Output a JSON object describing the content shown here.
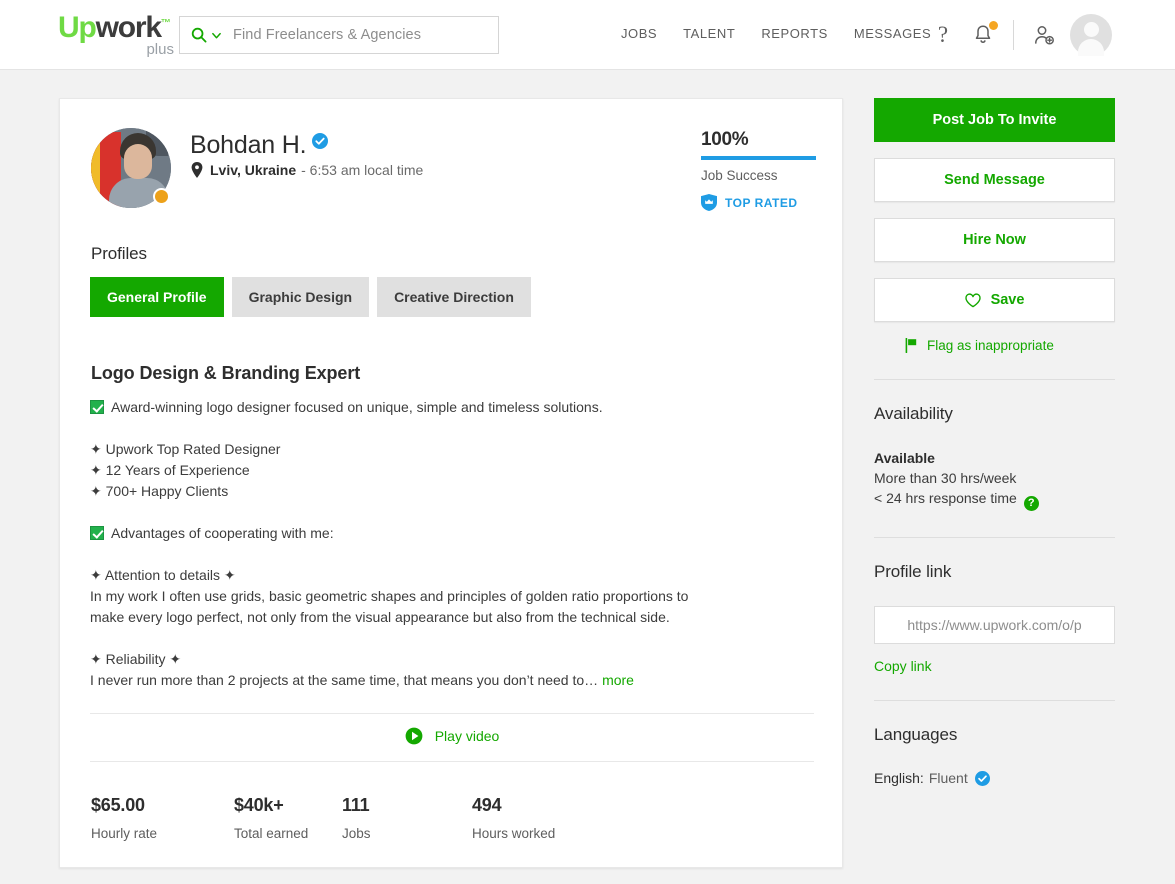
{
  "nav": {
    "logo": {
      "up": "Up",
      "work": "work",
      "tm": "™",
      "sub": "plus"
    },
    "search": {
      "placeholder": "Find Freelancers & Agencies",
      "icon": "search-icon"
    },
    "links": [
      "JOBS",
      "TALENT",
      "REPORTS",
      "MESSAGES"
    ],
    "help_icon": "?",
    "icons": [
      "help-icon",
      "notifications-bell-icon",
      "invite-person-icon",
      "user-avatar"
    ]
  },
  "profile": {
    "name": "Bohdan H.",
    "verified": true,
    "location": "Lviv, Ukraine",
    "local_time": "- 6:53 am local time",
    "online_status": "away",
    "job_success": {
      "percent": "100%",
      "label": "Job Success",
      "badge": "TOP RATED"
    },
    "profiles_label": "Profiles",
    "tabs": [
      {
        "label": "General Profile",
        "active": true
      },
      {
        "label": "Graphic Design",
        "active": false
      },
      {
        "label": "Creative Direction",
        "active": false
      }
    ],
    "headline": "Logo Design & Branding Expert",
    "description": {
      "line1": "Award-winning logo designer focused on unique, simple and timeless solutions.",
      "bullet1": "✦ Upwork Top Rated Designer",
      "bullet2": "✦ 12 Years of Experience",
      "bullet3": "✦ 700+ Happy Clients",
      "line2": "Advantages of cooperating with me:",
      "sub1_title": "✦ Attention to details ✦",
      "sub1_body_a": "In my work I often use grids, basic geometric shapes and principles of golden ratio proportions to",
      "sub1_body_b": "make every logo perfect, not only from the visual appearance but also from the technical side.",
      "sub2_title": "✦ Reliability ✦",
      "sub2_body": "I never run more than 2 projects at the same time, that means you don’t need to… ",
      "more": "more"
    },
    "play_video": "Play video",
    "stats": [
      {
        "value": "$65.00",
        "label": "Hourly rate"
      },
      {
        "value": "$40k+",
        "label": "Total earned"
      },
      {
        "value": "111",
        "label": "Jobs"
      },
      {
        "value": "494",
        "label": "Hours worked"
      }
    ]
  },
  "sidebar": {
    "buttons": [
      {
        "label": "Post Job To Invite",
        "style": "primary"
      },
      {
        "label": "Send Message",
        "style": "outline"
      },
      {
        "label": "Hire Now",
        "style": "outline"
      },
      {
        "label": "Save",
        "style": "outline",
        "icon": "heart-icon"
      }
    ],
    "flag": {
      "label": "Flag as inappropriate",
      "icon": "flag-icon"
    },
    "availability": {
      "title": "Availability",
      "status": "Available",
      "hours": "More than 30 hrs/week",
      "response": "< 24 hrs response time",
      "help": "?"
    },
    "profile_link": {
      "title": "Profile link",
      "value": "https://www.upwork.com/o/p",
      "copy": "Copy link"
    },
    "languages": {
      "title": "Languages",
      "entry_label": "English:",
      "entry_value": "Fluent",
      "verified": true
    }
  },
  "colors": {
    "green": "#14a800",
    "logo_green": "#6fda44",
    "blue": "#1f9ce4",
    "orange": "#f5a623",
    "page_bg": "#f2f2f2"
  }
}
